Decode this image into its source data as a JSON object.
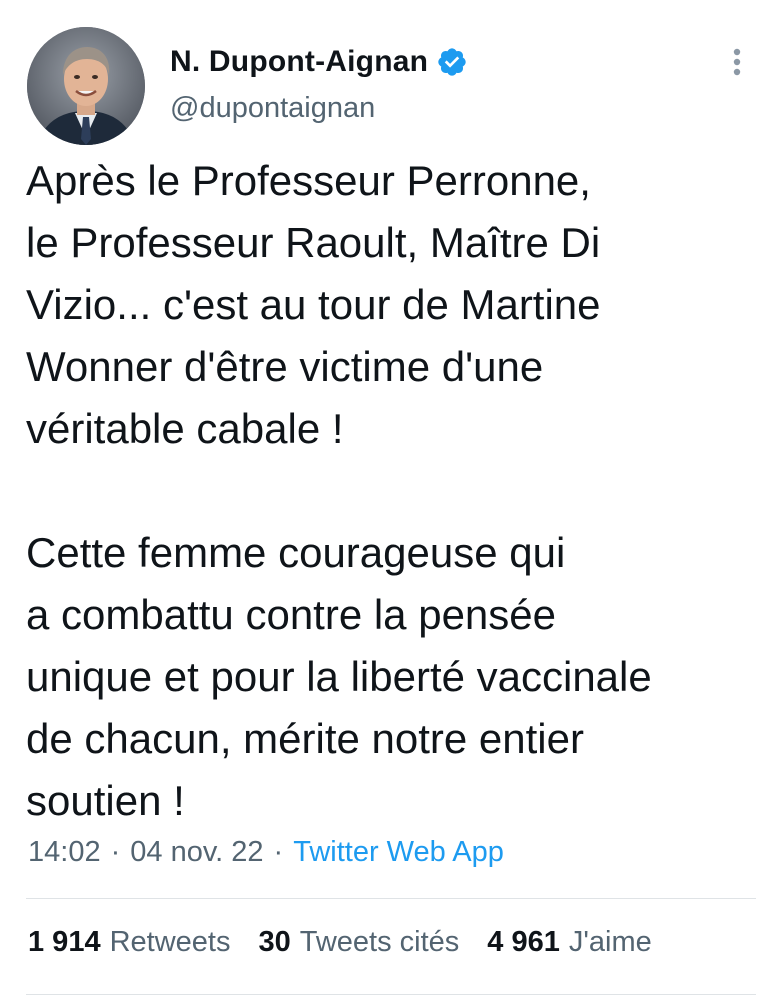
{
  "author": {
    "display_name": "N. Dupont-Aignan",
    "handle": "@dupontaignan",
    "verified_icon": "verified-badge-icon",
    "avatar_icon": "profile-photo"
  },
  "menu_icon": "more-options-icon",
  "tweet": {
    "paragraph1": [
      "Après le Professeur Perronne,",
      "le Professeur Raoult, Maître Di",
      "Vizio... c'est au tour de Martine",
      "Wonner d'être victime d'une",
      "véritable cabale !"
    ],
    "paragraph2": [
      "Cette femme courageuse qui",
      "a combattu contre la pensée",
      "unique et pour la liberté vaccinale",
      "de chacun, mérite notre entier",
      "soutien !"
    ]
  },
  "meta": {
    "time": "14:02",
    "separator": "·",
    "date": "04 nov. 22",
    "source": "Twitter Web App"
  },
  "stats": {
    "retweets_count": "1 914",
    "retweets_label": "Retweets",
    "quotes_count": "30",
    "quotes_label": "Tweets cités",
    "likes_count": "4 961",
    "likes_label": "J'aime"
  },
  "colors": {
    "text": "#0f1419",
    "secondary": "#536471",
    "accent": "#1d9bf0",
    "divider": "#dfe3e6"
  }
}
